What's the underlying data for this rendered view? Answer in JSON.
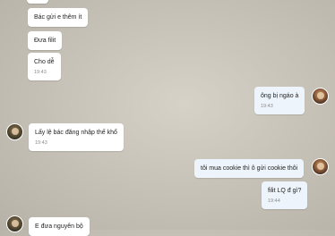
{
  "messages": [
    {
      "text": "Bác gửi e thêm ít",
      "time": ""
    },
    {
      "text": "Đưa filit",
      "time": ""
    },
    {
      "text": "Cho dễ",
      "time": "19:43"
    },
    {
      "text": "ông bị ngáo à",
      "time": "19:43"
    },
    {
      "text": "Lấy lệ bác đăng nhập thế khổ",
      "time": "19:43"
    },
    {
      "text": "tôi mua cookie thì ô gửi cookie thôi",
      "time": ""
    },
    {
      "text": "filit LQ đ gì?",
      "time": "19:44"
    },
    {
      "text": "E đưa nguyên bộ",
      "time": ""
    }
  ]
}
